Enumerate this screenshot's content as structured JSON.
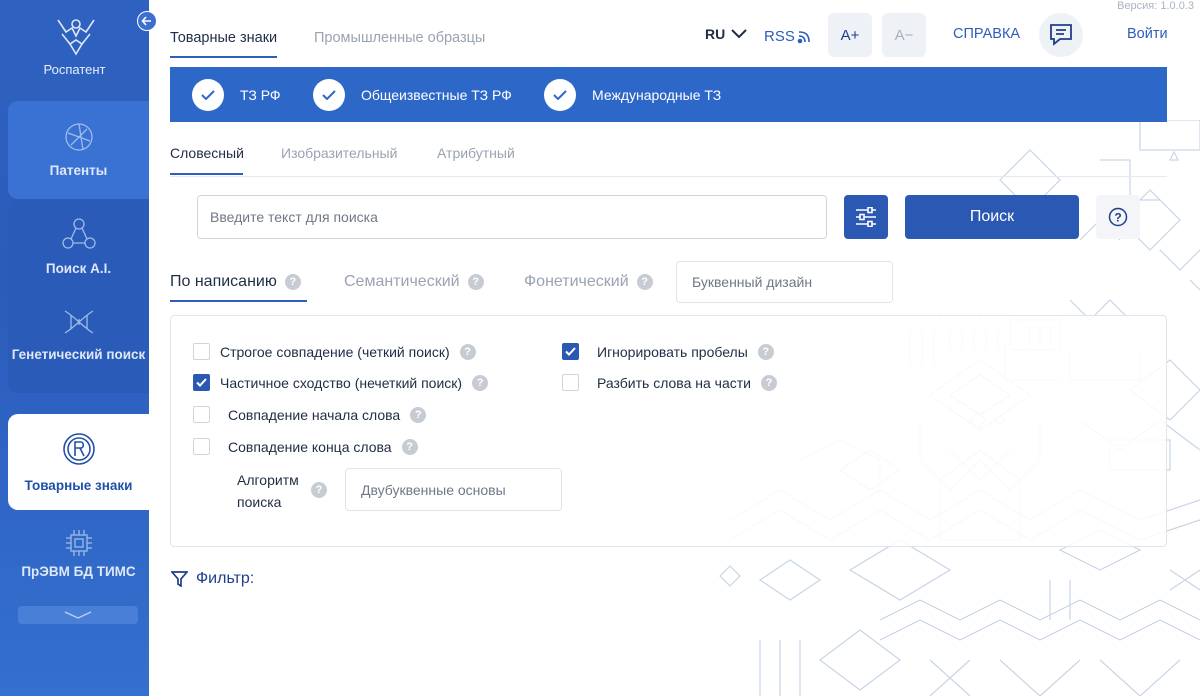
{
  "version": "Версия: 1.0.0.3",
  "sidebar": {
    "logo_label": "Роспатент",
    "items": [
      {
        "label": "Патенты",
        "icon": "globe-network-icon"
      },
      {
        "label": "Поиск A.I.",
        "icon": "ai-nodes-icon"
      },
      {
        "label": "Генетический поиск",
        "icon": "dna-icon"
      },
      {
        "label": "Товарные знаки",
        "icon": "registered-trademark-icon"
      },
      {
        "label": "ПрЭВМ БД ТИМС",
        "icon": "chip-icon"
      }
    ]
  },
  "header": {
    "tabs": [
      "Товарные знаки",
      "Промышленные образцы"
    ],
    "language": "RU",
    "rss": "RSS",
    "font_increase": "A+",
    "font_decrease": "A−",
    "help": "СПРАВКА",
    "login": "Войти"
  },
  "databases": [
    "ТЗ РФ",
    "Общеизвестные ТЗ РФ",
    "Международные ТЗ"
  ],
  "subtabs": [
    "Словесный",
    "Изобразительный",
    "Атрибутный"
  ],
  "search": {
    "placeholder": "Введите текст для поиска",
    "button": "Поиск",
    "help_symbol": "?"
  },
  "modes": [
    "По написанию",
    "Семантический",
    "Фонетический"
  ],
  "letter_design_placeholder": "Буквенный дизайн",
  "options": {
    "strict": {
      "label": "Строгое совпадение (четкий поиск)",
      "checked": false
    },
    "partial": {
      "label": "Частичное сходство (нечеткий поиск)",
      "checked": true
    },
    "word_start": {
      "label": "Совпадение начала слова",
      "checked": false
    },
    "word_end": {
      "label": "Совпадение конца слова",
      "checked": false
    },
    "ignore_spaces": {
      "label": "Игнорировать пробелы",
      "checked": true
    },
    "split_words": {
      "label": "Разбить слова на части",
      "checked": false
    }
  },
  "algorithm": {
    "label": "Алгоритм поиска",
    "value": "Двубуквенные основы"
  },
  "filter_label": "Фильтр:",
  "colors": {
    "primary": "#2a58b3",
    "bar": "#2d68c9",
    "sidebar": "#2f62c0"
  }
}
